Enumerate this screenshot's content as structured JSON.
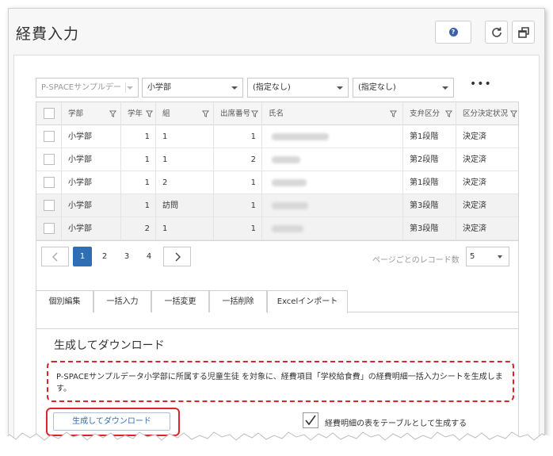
{
  "app": {
    "title": "経費入力"
  },
  "toolbar": {
    "help_icon": "question-circle-icon",
    "refresh_icon": "refresh-icon",
    "popout_icon": "popout-window-icon"
  },
  "filters": {
    "school": "P-SPACEサンプルデー",
    "division": "小学部",
    "filter2": "(指定なし)",
    "filter3": "(指定なし)",
    "more": "•••"
  },
  "grid": {
    "columns": [
      "学部",
      "学年",
      "組",
      "出席番号",
      "氏名",
      "支弁区分",
      "区分決定状況"
    ],
    "rows": [
      {
        "dept": "小学部",
        "grade": "1",
        "class": "1",
        "no": "1",
        "support": "第1段階",
        "status": "決定済"
      },
      {
        "dept": "小学部",
        "grade": "1",
        "class": "1",
        "no": "2",
        "support": "第2段階",
        "status": "決定済"
      },
      {
        "dept": "小学部",
        "grade": "1",
        "class": "2",
        "no": "1",
        "support": "第1段階",
        "status": "決定済"
      },
      {
        "dept": "小学部",
        "grade": "1",
        "class": "訪問",
        "no": "1",
        "support": "第3段階",
        "status": "決定済"
      },
      {
        "dept": "小学部",
        "grade": "2",
        "class": "1",
        "no": "1",
        "support": "第3段階",
        "status": "決定済"
      }
    ]
  },
  "pager": {
    "pages": [
      "1",
      "2",
      "3",
      "4"
    ],
    "current": "1",
    "page_size_label": "ページごとのレコード数",
    "page_size": "5"
  },
  "tabs": [
    "個別編集",
    "一括入力",
    "一括変更",
    "一括削除",
    "Excelインポート"
  ],
  "panel": {
    "title": "生成してダウンロード",
    "notice": "P-SPACEサンプルデータ小学部に所属する児童生徒 を対象に、経費項目「学校給食費」の経費明細一括入力シートを生成します。",
    "generate_button": "生成してダウンロード",
    "table_checkbox_label": "経費明細の表をテーブルとして生成する"
  },
  "colors": {
    "accent": "#2f6db5",
    "highlight": "#d9262c"
  }
}
